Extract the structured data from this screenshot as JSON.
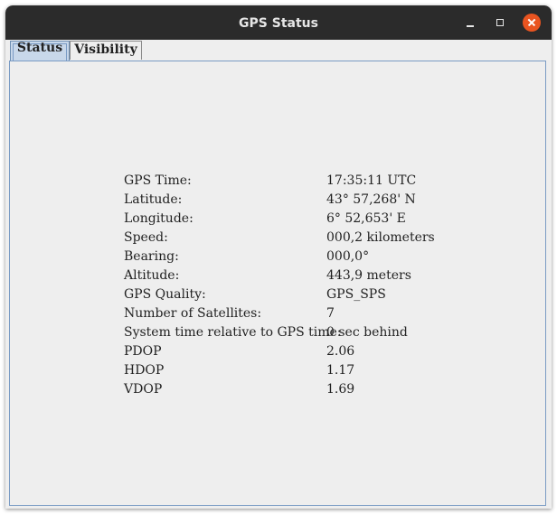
{
  "window": {
    "title": "GPS Status"
  },
  "tabs": [
    {
      "label": "Status",
      "active": true
    },
    {
      "label": "Visibility",
      "active": false
    }
  ],
  "status": {
    "rows": [
      {
        "label": "GPS Time:",
        "value": "17:35:11 UTC"
      },
      {
        "label": "Latitude:",
        "value": "43° 57,268' N"
      },
      {
        "label": "Longitude:",
        "value": "6° 52,653' E"
      },
      {
        "label": "Speed:",
        "value": "000,2 kilometers"
      },
      {
        "label": "Bearing:",
        "value": "000,0°"
      },
      {
        "label": "Altitude:",
        "value": "443,9 meters"
      },
      {
        "label": "GPS Quality:",
        "value": "GPS_SPS"
      },
      {
        "label": "Number of Satellites:",
        "value": "7"
      },
      {
        "label": "System time relative to GPS time:",
        "value": "0 sec behind"
      },
      {
        "label": "PDOP",
        "value": "2.06"
      },
      {
        "label": "HDOP",
        "value": "1.17"
      },
      {
        "label": "VDOP",
        "value": "1.69"
      }
    ]
  },
  "colors": {
    "titlebar": "#2b2b2b",
    "close_button": "#e95420",
    "active_tab": "#c8d8ea",
    "panel_border": "#7a9bc4",
    "background": "#eeeeee"
  }
}
